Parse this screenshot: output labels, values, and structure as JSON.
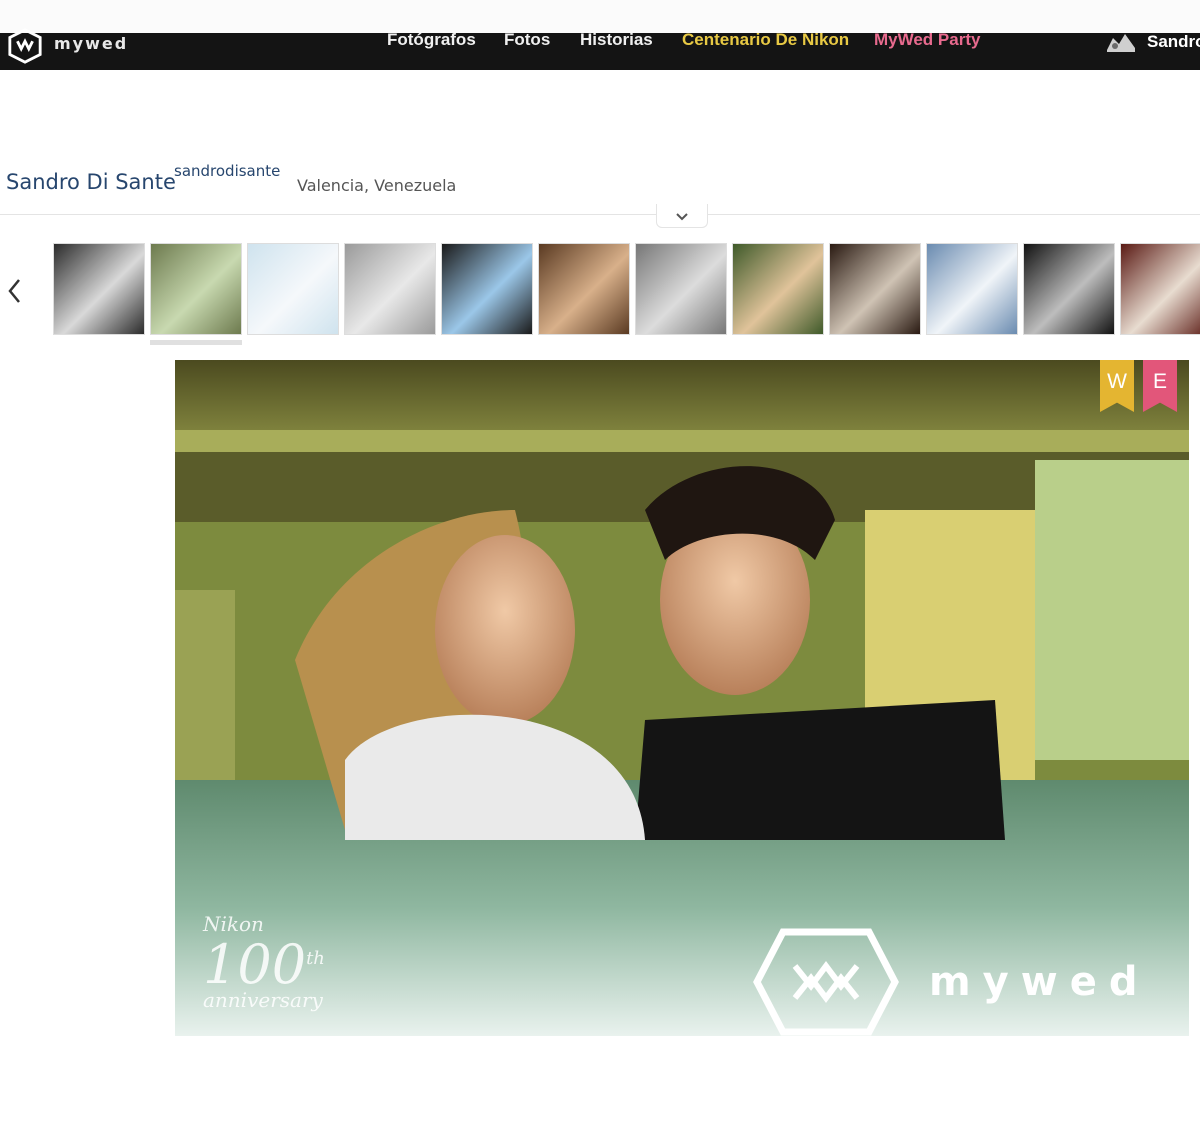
{
  "nav": {
    "brand": "mywed",
    "items": [
      {
        "label": "Fotógrafos"
      },
      {
        "label": "Fotos"
      },
      {
        "label": "Historias"
      },
      {
        "label": "Centenario De Nikon"
      },
      {
        "label": "MyWed Party"
      }
    ],
    "user": "Sandro"
  },
  "profile": {
    "name": "Sandro Di Sante",
    "handle": "sandrodisante",
    "location": "Valencia, Venezuela"
  },
  "thumbnails": [
    {
      "name": "thumb-couple-bw",
      "colors": [
        "#2b2b2b",
        "#d9d9d9"
      ]
    },
    {
      "name": "thumb-couple-pool",
      "colors": [
        "#6d7a4e",
        "#c8d9b0"
      ],
      "selected": true
    },
    {
      "name": "thumb-snow-scene",
      "colors": [
        "#cfe3ee",
        "#f5f8fb"
      ]
    },
    {
      "name": "thumb-bride-veil",
      "colors": [
        "#9a9a9a",
        "#e8e8e8"
      ]
    },
    {
      "name": "thumb-balloons",
      "colors": [
        "#1a1a1a",
        "#9bc7e8"
      ]
    },
    {
      "name": "thumb-couple-kiss",
      "colors": [
        "#5a3a22",
        "#d8b08a"
      ]
    },
    {
      "name": "thumb-couple-street",
      "colors": [
        "#777777",
        "#dcdcdc"
      ]
    },
    {
      "name": "thumb-garden-table",
      "colors": [
        "#3f5a2a",
        "#e0c39a"
      ]
    },
    {
      "name": "thumb-bride-window",
      "colors": [
        "#2a1a12",
        "#cfc3b4"
      ]
    },
    {
      "name": "thumb-horse-mountains",
      "colors": [
        "#6a8bb0",
        "#f0f4f8"
      ]
    },
    {
      "name": "thumb-rings-bw",
      "colors": [
        "#121212",
        "#bdbdbd"
      ]
    },
    {
      "name": "thumb-bride-red",
      "colors": [
        "#5a1a14",
        "#e8dcd0"
      ]
    }
  ],
  "photo": {
    "badges": [
      "W",
      "E"
    ],
    "watermark_nikon": [
      "Nikon",
      "100",
      "anniversary"
    ],
    "watermark_nikon_sup": "th",
    "watermark_brand": "mywed"
  }
}
